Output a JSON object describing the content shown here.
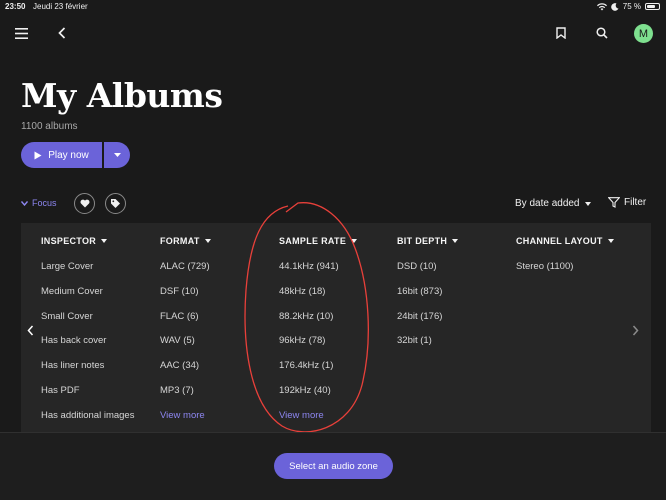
{
  "status": {
    "time": "23:50",
    "date": "Jeudi 23 février",
    "battery": "75 %",
    "battery_level": 0.75
  },
  "toolbar": {
    "avatar_initial": "M"
  },
  "page": {
    "title": "My Albums",
    "count": "1100 albums"
  },
  "actions": {
    "play_label": "Play now",
    "focus_label": "Focus",
    "sort_label": "By date added",
    "filter_label": "Filter"
  },
  "columns": [
    {
      "header": "INSPECTOR",
      "items": [
        "Large Cover",
        "Medium Cover",
        "Small Cover",
        "Has back cover",
        "Has liner notes",
        "Has PDF",
        "Has additional images"
      ]
    },
    {
      "header": "FORMAT",
      "items": [
        "ALAC (729)",
        "DSF (10)",
        "FLAC (6)",
        "WAV (5)",
        "AAC (34)",
        "MP3 (7)"
      ],
      "more": "View more"
    },
    {
      "header": "SAMPLE RATE",
      "items": [
        "44.1kHz (941)",
        "48kHz (18)",
        "88.2kHz (10)",
        "96kHz (78)",
        "176.4kHz (1)",
        "192kHz (40)"
      ],
      "more": "View more"
    },
    {
      "header": "BIT DEPTH",
      "items": [
        "DSD (10)",
        "16bit (873)",
        "24bit (176)",
        "32bit (1)"
      ]
    },
    {
      "header": "CHANNEL LAYOUT",
      "items": [
        "Stereo (1100)"
      ]
    }
  ],
  "footer": {
    "audio_zone_label": "Select an audio zone"
  },
  "colors": {
    "accent": "#6b63d9",
    "link": "#8d86f0",
    "avatar": "#7ee08f",
    "annotation": "#e8403a"
  }
}
